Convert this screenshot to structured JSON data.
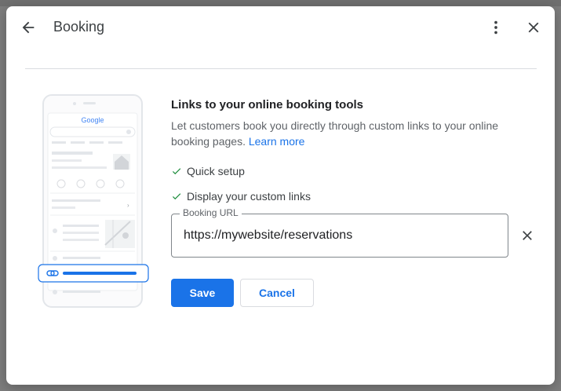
{
  "dialog": {
    "title": "Booking",
    "heading": "Links to your online booking tools",
    "description": "Let customers book you directly through custom links to your online booking pages.",
    "learn_more": "Learn more",
    "features": [
      "Quick setup",
      "Display your custom links"
    ],
    "field": {
      "label": "Booking URL",
      "value": "https://mywebsite/reservations"
    },
    "save_label": "Save",
    "cancel_label": "Cancel"
  },
  "illustration": {
    "brand": "Google"
  },
  "icons": {
    "back": "arrow-back-icon",
    "more": "more-vert-icon",
    "close": "close-icon",
    "check": "check-icon",
    "clear": "clear-icon"
  },
  "colors": {
    "accent": "#1a73e8",
    "check": "#1e8e3e",
    "text": "#3c4043"
  }
}
